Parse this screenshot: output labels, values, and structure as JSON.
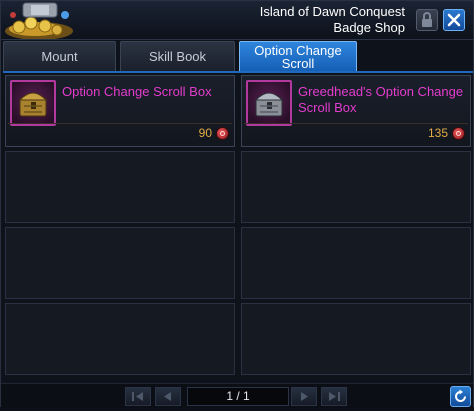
{
  "window": {
    "title_line1": "Island of Dawn Conquest",
    "title_line2": "Badge Shop"
  },
  "header": {
    "lock_icon": "lock-icon",
    "close_icon": "close-icon",
    "art_icon": "treasure-coins-icon"
  },
  "tabs": [
    {
      "label": "Mount",
      "active": false
    },
    {
      "label": "Skill Book",
      "active": false
    },
    {
      "label": "Option Change Scroll",
      "active": true
    }
  ],
  "items": [
    {
      "name": "Option Change Scroll Box",
      "price": "90",
      "icon": "gold-chest-icon",
      "currency_icon": "badge-currency-icon"
    },
    {
      "name": "Greedhead's Option Change Scroll Box",
      "price": "135",
      "icon": "silver-chest-icon",
      "currency_icon": "badge-currency-icon"
    }
  ],
  "pagination": {
    "page": "1 / 1",
    "first_icon": "first-page-icon",
    "prev_icon": "prev-page-icon",
    "next_icon": "next-page-icon",
    "last_icon": "last-page-icon",
    "refresh_icon": "refresh-icon"
  },
  "colors": {
    "accent_blue": "#1f6fc8",
    "item_name": "#e43cce",
    "price": "#e4ad47"
  }
}
